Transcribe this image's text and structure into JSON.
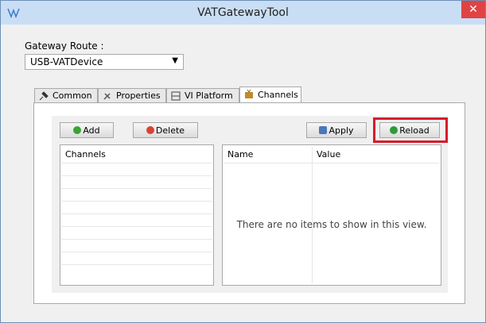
{
  "window": {
    "title": "VATGatewayTool",
    "close_symbol": "✕"
  },
  "route": {
    "label": "Gateway Route :",
    "selected": "USB-VATDevice"
  },
  "tabs": [
    {
      "label": "Common",
      "icon": "pin-icon"
    },
    {
      "label": "Properties",
      "icon": "tools-icon"
    },
    {
      "label": "VI Platform",
      "icon": "filmstrip-icon"
    },
    {
      "label": "Channels",
      "icon": "tv-icon",
      "active": true
    }
  ],
  "toolbar": {
    "add_label": "Add",
    "delete_label": "Delete",
    "apply_label": "Apply",
    "reload_label": "Reload"
  },
  "channels": {
    "header": "Channels",
    "items": []
  },
  "details": {
    "name_header": "Name",
    "value_header": "Value",
    "empty_message": "There are no items to show in this view."
  },
  "colors": {
    "highlight": "#d81b2a",
    "add_icon": "#3aa335",
    "delete_icon": "#d84335",
    "reload_icon": "#2e9b3a",
    "apply_icon": "#4a78b8"
  }
}
